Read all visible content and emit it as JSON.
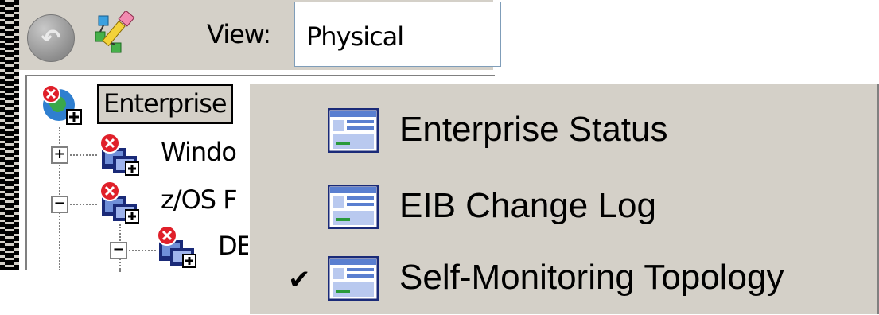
{
  "toolbar": {
    "view_label": "View:",
    "view_value": "Physical"
  },
  "tree": {
    "root": {
      "label": "Enterprise",
      "icon": "enterprise-globe-icon"
    },
    "nodes": [
      {
        "label": "Windo",
        "expander": "+",
        "icon": "managed-system-error-icon"
      },
      {
        "label": "z/OS F",
        "expander": "−",
        "icon": "managed-system-error-icon"
      },
      {
        "label": "DE",
        "expander": "−",
        "icon": "managed-system-error-icon"
      }
    ]
  },
  "context_menu": {
    "items": [
      {
        "label": "Enterprise Status",
        "checked": false,
        "icon": "workspace-icon"
      },
      {
        "label": "EIB Change Log",
        "checked": false,
        "icon": "workspace-icon"
      },
      {
        "label": "Self-Monitoring Topology",
        "checked": true,
        "check_mark": "✔",
        "icon": "workspace-icon"
      }
    ]
  },
  "colors": {
    "window_bg": "#d4d0c8",
    "error_red": "#e0202a",
    "icon_navy": "#1a2a78"
  }
}
